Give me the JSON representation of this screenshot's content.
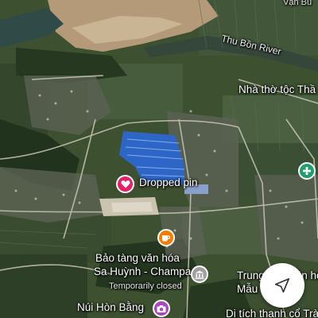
{
  "map": {
    "labels": {
      "top_right_partial": "Vạn Bu",
      "river": "Thu Bồn River",
      "church": "Nhà thờ tộc Thầ",
      "dropped_pin": "Dropped pin",
      "museum_line1": "Bảo tàng văn hóa",
      "museum_line2": "Sa Huỳnh - Champa",
      "museum_status": "Temporarily closed",
      "trung_line1": "Trung tâm Văn hóa",
      "trung_line2": "Mẫu Tr...",
      "nui_hon_bang": "Núi Hòn Bằng",
      "di_tich": "Di tích thạnh cổ Trà..."
    },
    "icons": {
      "dropped_pin": "heart-icon",
      "museum": "coffee-cup-icon",
      "camera": "camera-icon",
      "building": "building-icon",
      "church": "flower-icon",
      "navigate": "navigation-arrow-icon"
    },
    "colors": {
      "dropped_pin": "#e91e63",
      "museum": "#f57c00",
      "camera": "#ab47bc",
      "church": "#1e9e6a",
      "building": "#9e9e9e"
    }
  }
}
